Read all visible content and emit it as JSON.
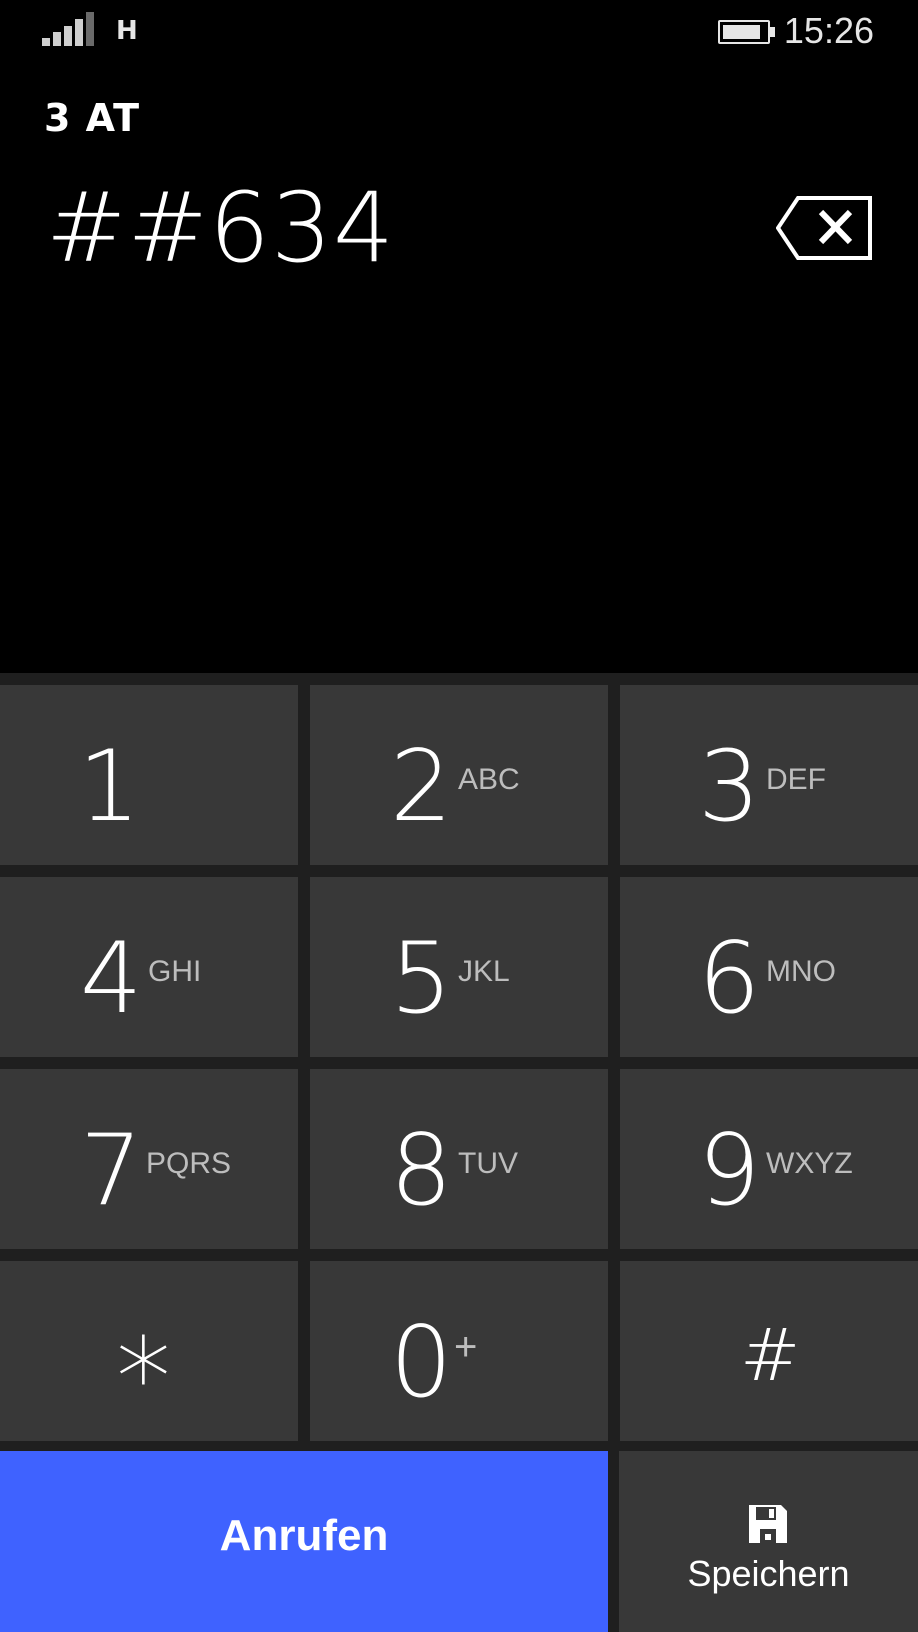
{
  "status": {
    "network_type": "H",
    "time": "15:26",
    "signal_icon": "signal-strength-icon",
    "battery_icon": "battery-icon"
  },
  "carrier": "3 AT",
  "dialed_number": "##634",
  "keys": [
    {
      "digit": "1",
      "letters": ""
    },
    {
      "digit": "2",
      "letters": "ABC"
    },
    {
      "digit": "3",
      "letters": "DEF"
    },
    {
      "digit": "4",
      "letters": "GHI"
    },
    {
      "digit": "5",
      "letters": "JKL"
    },
    {
      "digit": "6",
      "letters": "MNO"
    },
    {
      "digit": "7",
      "letters": "PQRS"
    },
    {
      "digit": "8",
      "letters": "TUV"
    },
    {
      "digit": "9",
      "letters": "WXYZ"
    },
    {
      "digit": "*",
      "letters": ""
    },
    {
      "digit": "0",
      "letters": "+"
    },
    {
      "digit": "#",
      "letters": ""
    }
  ],
  "actions": {
    "call_label": "Anrufen",
    "save_label": "Speichern"
  },
  "colors": {
    "accent": "#3f62ff",
    "key_bg": "#383838",
    "background": "#000000"
  }
}
